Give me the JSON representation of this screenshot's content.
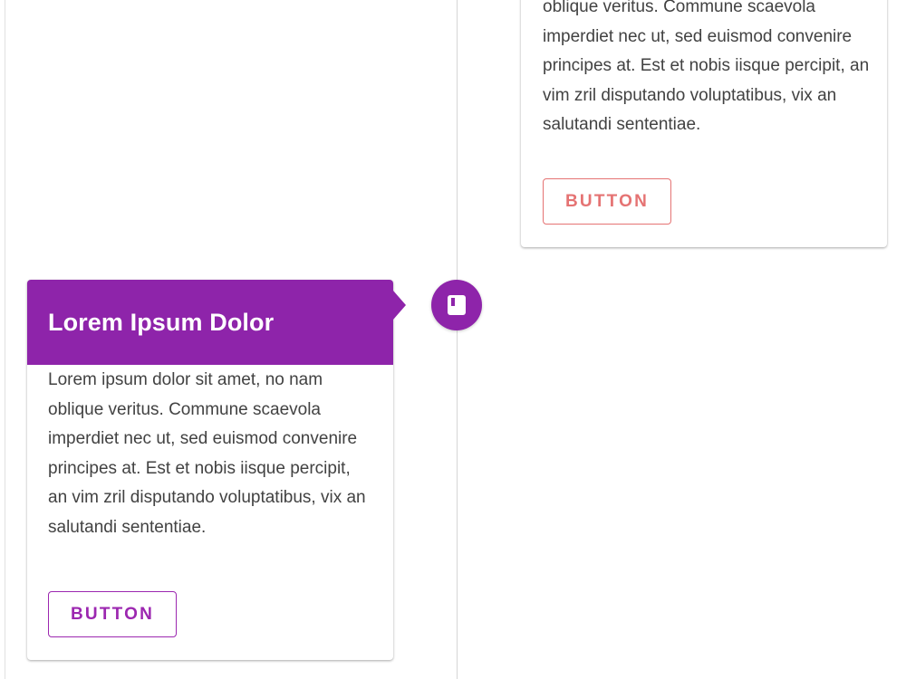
{
  "timeline": {
    "dot_icon": "book-icon",
    "accent_color": "#8e24aa"
  },
  "cards": [
    {
      "title": "",
      "body_visible": "imperdiet nec ut, sed euismod convenire principes at. Est et nobis iisque percipit, an vim zril disputando voluptatibus, vix an salutandi sententiae.",
      "body_cut_top": "oblique veritus. Commune scaevola",
      "button_label": "BUTTON",
      "button_color": "#e57373"
    },
    {
      "title": "Lorem Ipsum Dolor",
      "body": "Lorem ipsum dolor sit amet, no nam oblique veritus. Commune scaevola imperdiet nec ut, sed euismod convenire principes at. Est et nobis iisque percipit, an vim zril disputando voluptatibus, vix an salutandi sententiae.",
      "button_label": "BUTTON",
      "header_color": "#8e24aa",
      "button_color": "#9c27b0"
    }
  ]
}
